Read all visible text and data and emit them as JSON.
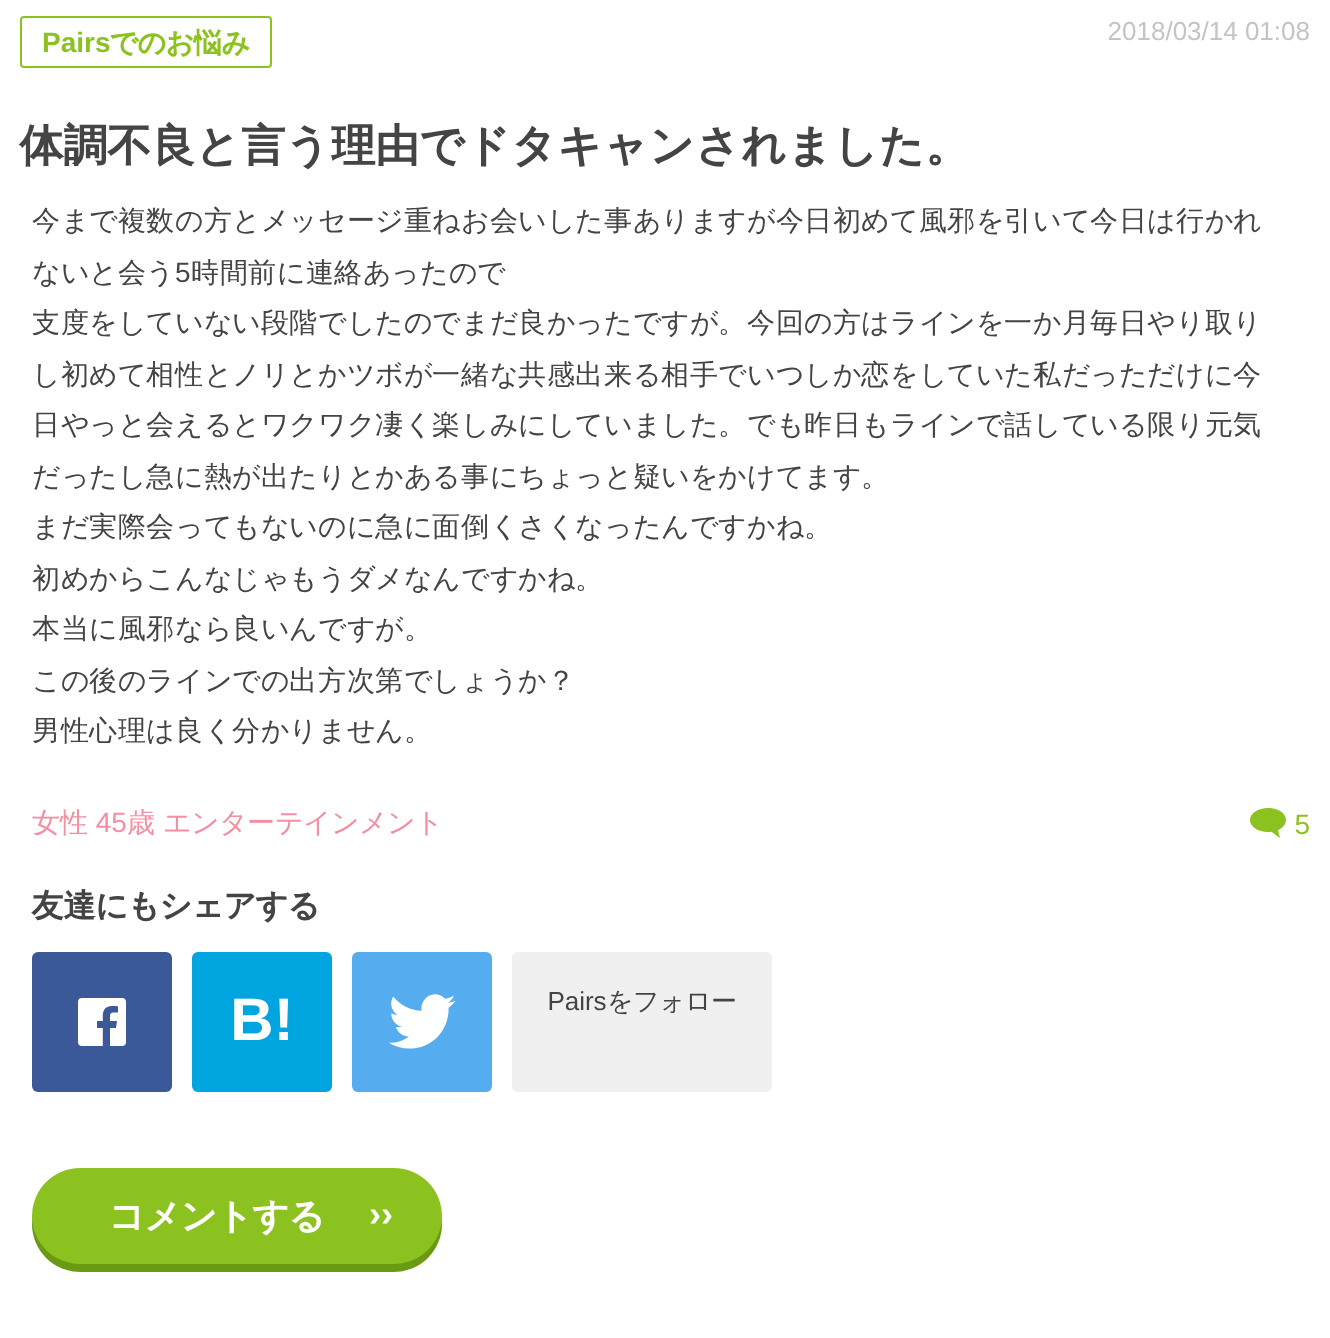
{
  "category_tag": "Pairsでのお悩み",
  "date": "2018/03/14 01:08",
  "title": "体調不良と言う理由でドタキャンされました。",
  "body": [
    "今まで複数の方とメッセージ重ねお会いした事ありますが今日初めて風邪を引いて今日は行かれないと会う5時間前に連絡あったので",
    "支度をしていない段階でしたのでまだ良かったですが。今回の方はラインを一か月毎日やり取りし初めて相性とノリとかツボが一緒な共感出来る相手でいつしか恋をしていた私だっただけに今日やっと会えるとワクワク凄く楽しみにしていました。でも昨日もラインで話している限り元気だったし急に熱が出たりとかある事にちょっと疑いをかけてます。",
    "まだ実際会ってもないのに急に面倒くさくなったんですかね。",
    "初めからこんなじゃもうダメなんですかね。",
    "本当に風邪なら良いんですが。",
    "この後のラインでの出方次第でしょうか？",
    "男性心理は良く分かりません。"
  ],
  "author_meta": "女性 45歳 エンターテインメント",
  "comment_count": "5",
  "share": {
    "heading": "友達にもシェアする",
    "buttons": [
      {
        "kind": "facebook"
      },
      {
        "kind": "hatena",
        "label": "B!"
      },
      {
        "kind": "twitter"
      },
      {
        "kind": "follow",
        "label": "Pairsをフォロー"
      }
    ]
  },
  "comment_button": {
    "label": "コメントする",
    "arrow": "››"
  }
}
